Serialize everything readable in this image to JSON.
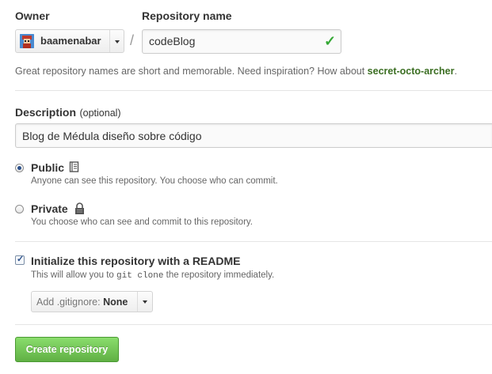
{
  "owner": {
    "label": "Owner",
    "value": "baamenabar"
  },
  "repo": {
    "label": "Repository name",
    "value": "codeBlog",
    "separator": "/"
  },
  "hint": {
    "text": "Great repository names are short and memorable. Need inspiration? How about ",
    "suggestion": "secret-octo-archer",
    "end": "."
  },
  "description": {
    "label": "Description",
    "optional": "(optional)",
    "value": "Blog de Médula diseño sobre código"
  },
  "visibility": {
    "selected": "public",
    "public": {
      "title": "Public",
      "desc": "Anyone can see this repository. You choose who can commit.",
      "icon": "book-icon"
    },
    "private": {
      "title": "Private",
      "desc": "You choose who can see and commit to this repository.",
      "icon": "lock-icon"
    }
  },
  "readme": {
    "checked": true,
    "title": "Initialize this repository with a README",
    "desc_before": "This will allow you to ",
    "desc_code": "git clone",
    "desc_after": " the repository immediately."
  },
  "gitignore": {
    "label": "Add .gitignore:",
    "value": "None"
  },
  "create_button": "Create repository",
  "colors": {
    "accent_green": "#60b044",
    "suggestion": "#3b6e22",
    "check": "#35a835"
  }
}
